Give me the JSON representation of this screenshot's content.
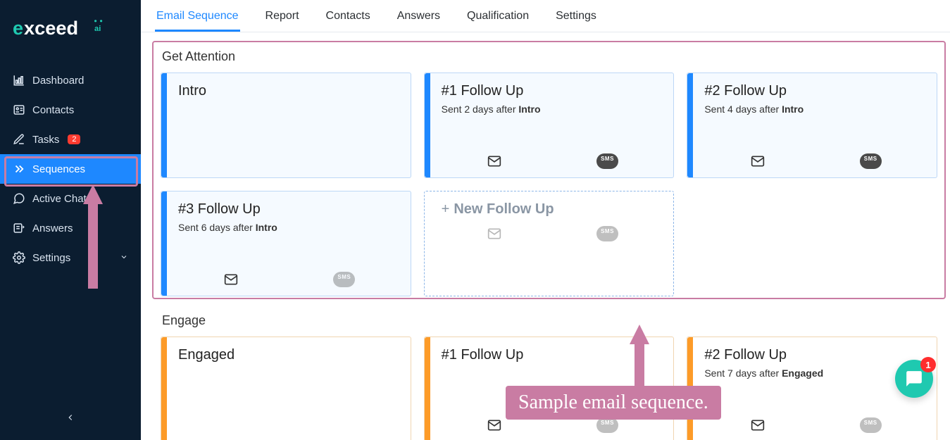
{
  "brand": {
    "name": "exceed",
    "suffix": ".ai"
  },
  "sidebar": {
    "items": [
      {
        "label": "Dashboard",
        "icon": "chart"
      },
      {
        "label": "Contacts",
        "icon": "contacts"
      },
      {
        "label": "Tasks",
        "icon": "edit",
        "badge": "2"
      },
      {
        "label": "Sequences",
        "icon": "chevrons",
        "active": true
      },
      {
        "label": "Active Chats",
        "icon": "chat"
      },
      {
        "label": "Answers",
        "icon": "answers"
      },
      {
        "label": "Settings",
        "icon": "gear",
        "caret": true
      }
    ]
  },
  "tabs": [
    {
      "label": "Email Sequence",
      "active": true
    },
    {
      "label": "Report"
    },
    {
      "label": "Contacts"
    },
    {
      "label": "Answers"
    },
    {
      "label": "Qualification"
    },
    {
      "label": "Settings"
    }
  ],
  "sections": {
    "attention": {
      "title": "Get Attention",
      "cards": [
        {
          "title": "Intro",
          "sub": "",
          "email": true,
          "sms": false,
          "show_icons": false
        },
        {
          "title": "#1 Follow Up",
          "sub_pre": "Sent 2 days after ",
          "sub_b": "Intro",
          "email": true,
          "sms": true
        },
        {
          "title": "#2 Follow Up",
          "sub_pre": "Sent 4 days after ",
          "sub_b": "Intro",
          "email": true,
          "sms": true
        },
        {
          "title": "#3 Follow Up",
          "sub_pre": "Sent 6 days after ",
          "sub_b": "Intro",
          "email": true,
          "sms": true,
          "muted": true
        },
        {
          "title": "New Follow Up",
          "new": true,
          "email": true,
          "sms": true,
          "muted": true
        }
      ]
    },
    "engage": {
      "title": "Engage",
      "cards": [
        {
          "title": "Engaged",
          "sub": "",
          "show_icons": false
        },
        {
          "title": "#1 Follow Up",
          "sub_pre": "",
          "sub_b": "",
          "email": true,
          "sms": true
        },
        {
          "title": "#2 Follow Up",
          "sub_pre": "Sent 7 days after ",
          "sub_b": "Engaged",
          "email": true,
          "sms": true,
          "muted": true
        }
      ]
    }
  },
  "annotation": {
    "caption": "Sample email sequence."
  },
  "chat": {
    "unread": "1"
  }
}
